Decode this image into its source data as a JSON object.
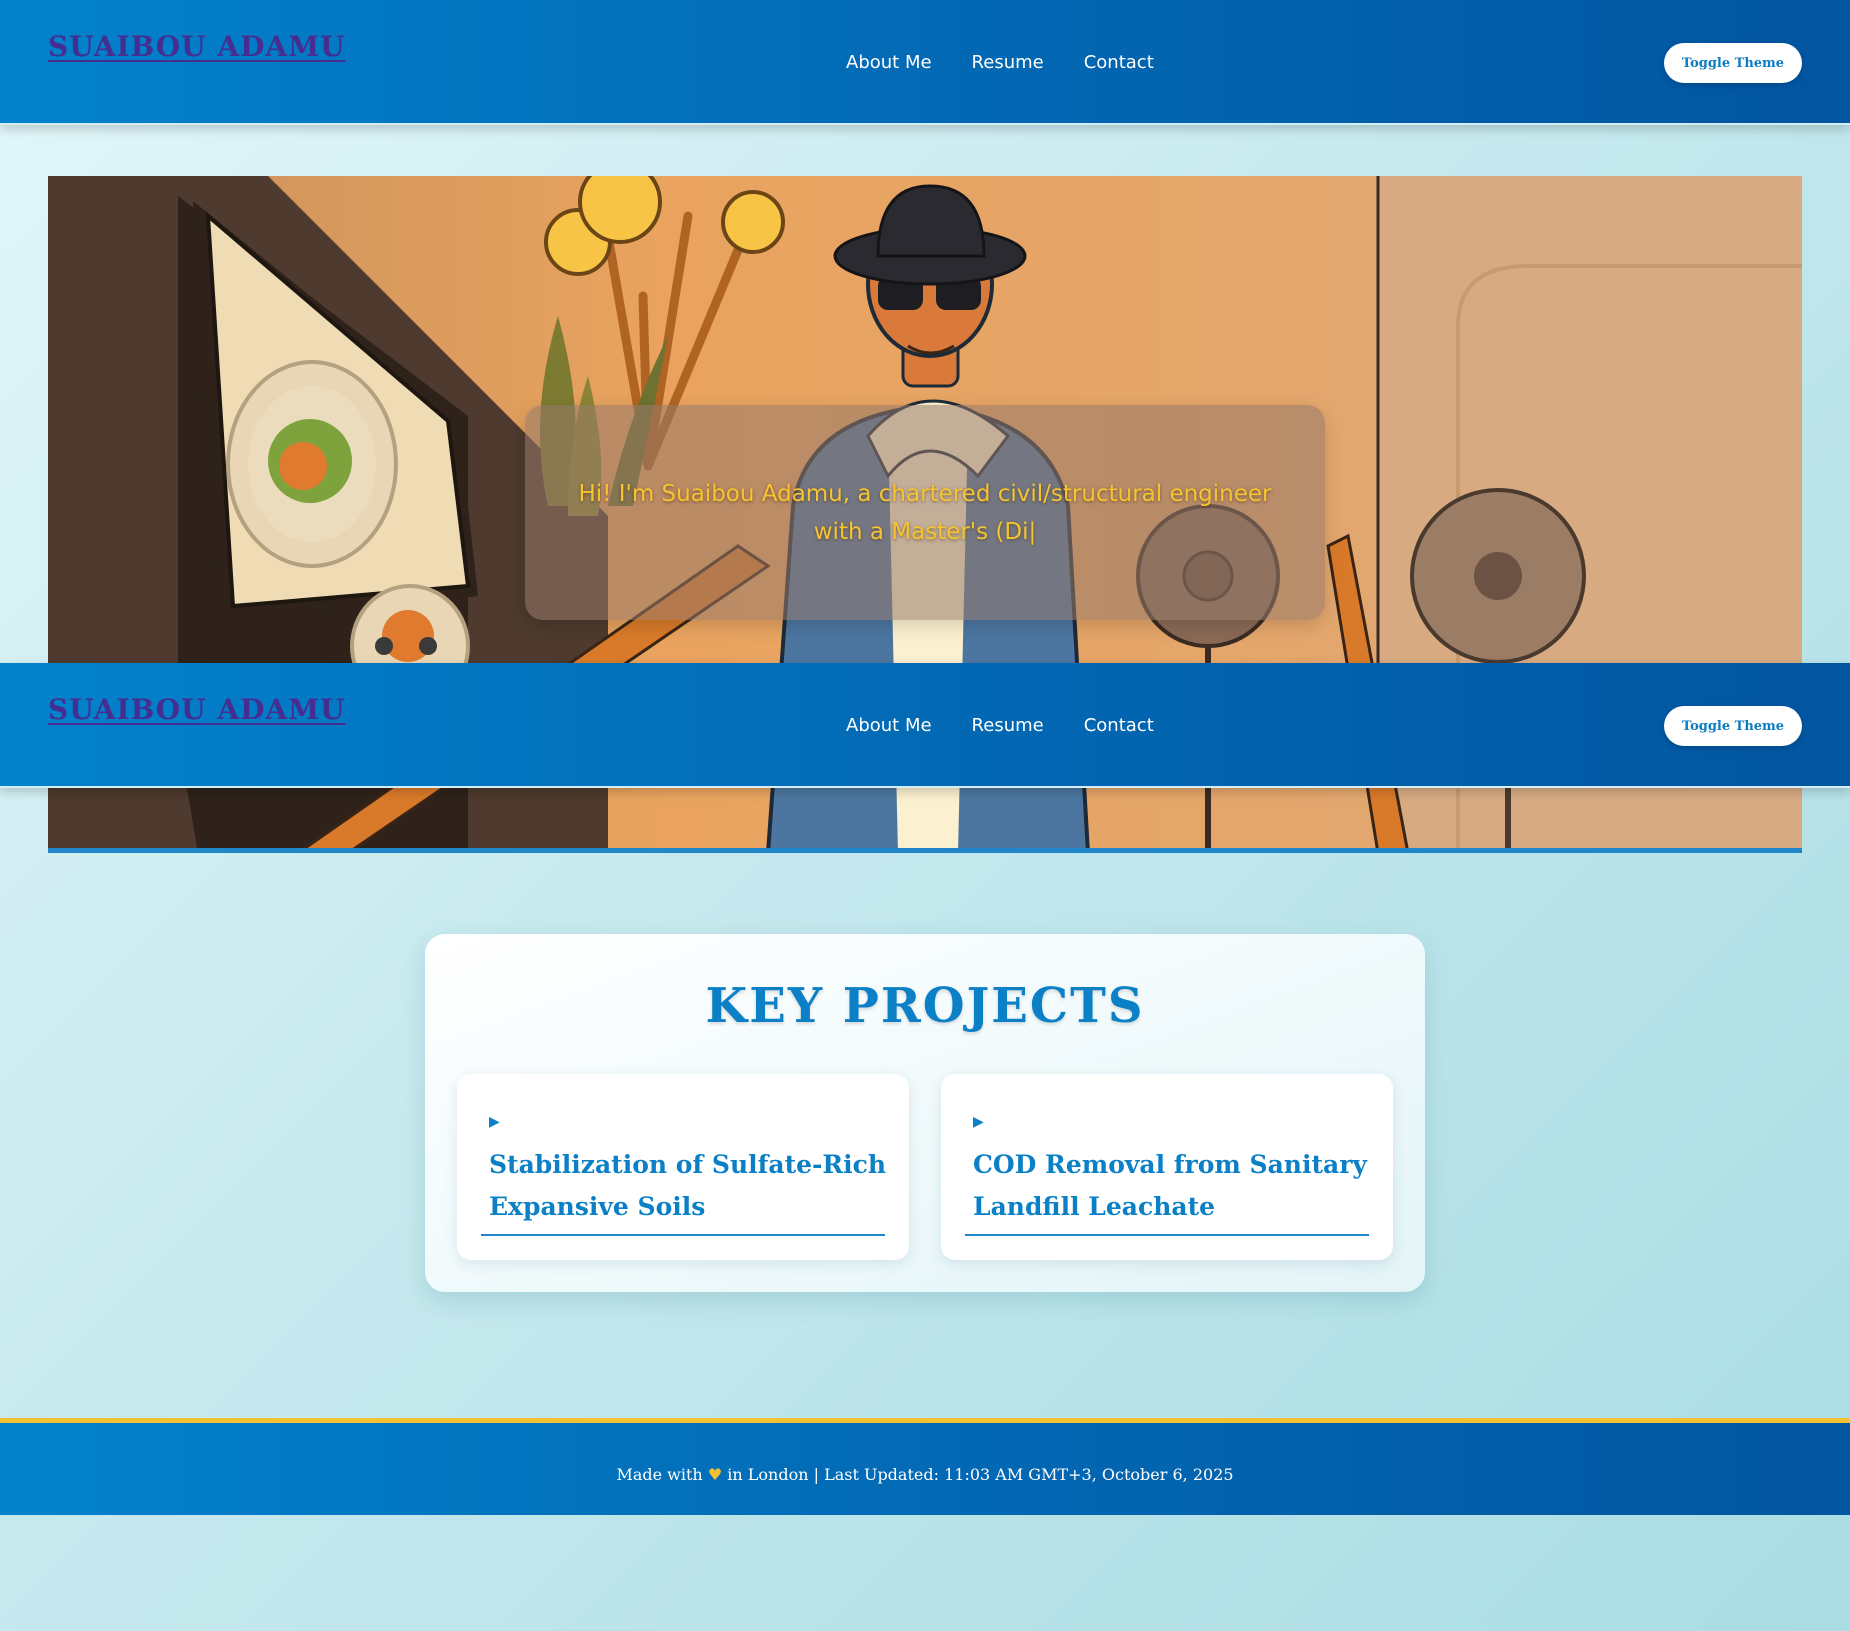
{
  "header": {
    "logo": "SUAIBOU ADAMU",
    "nav": [
      "About Me",
      "Resume",
      "Contact"
    ],
    "toggle_label": "Toggle Theme"
  },
  "hero": {
    "intro": "Hi! I'm Suaibou Adamu, a chartered civil/structural engineer with a Master's (Di|"
  },
  "projects": {
    "title": "KEY PROJECTS",
    "items": [
      {
        "arrow": "▶",
        "name": "Stabilization of Sulfate-Rich Expansive Soils"
      },
      {
        "arrow": "▶",
        "name": "COD Removal from Sanitary Landfill Leachate"
      }
    ]
  },
  "footer": {
    "prefix": "Made with",
    "heart": "♥",
    "suffix": "in London | Last Updated: 11:03 AM GMT+3, October 6, 2025"
  },
  "colors": {
    "header_blue": "#0367b3",
    "logo_purple": "#452d91",
    "accent_blue": "#0b80c6",
    "intro_yellow": "#f6c431",
    "footer_border": "#f2c233"
  }
}
